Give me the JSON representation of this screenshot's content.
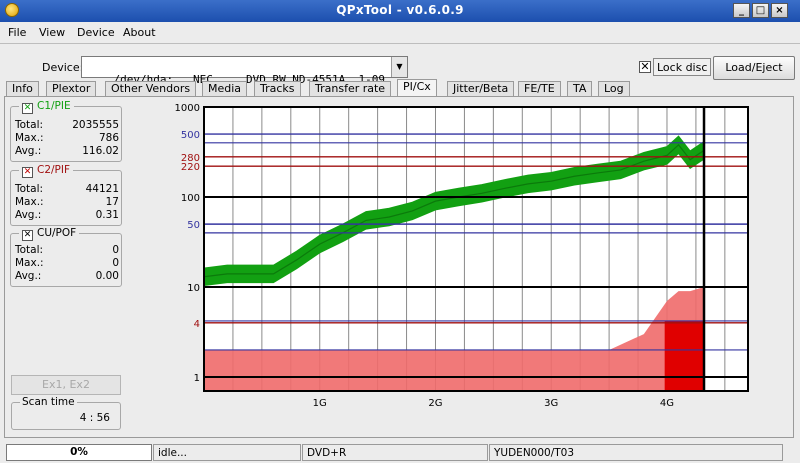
{
  "window": {
    "title": "QPxTool - v0.6.0.9"
  },
  "menu": [
    "File",
    "View",
    "Device",
    "About"
  ],
  "device": {
    "label": "Device:",
    "value": "/dev/hda:  _NEC     DVD_RW ND-4551A  1-09"
  },
  "lock": {
    "label": "Lock disc",
    "checked": true
  },
  "eject_label": "Load/Eject",
  "tabs": [
    "Info",
    "Plextor",
    "Other Vendors",
    "Media",
    "Tracks",
    "Transfer rate",
    "PI/Cx",
    "Jitter/Beta",
    "FE/TE",
    "TA",
    "Log"
  ],
  "active_tab": "PI/Cx",
  "stats": {
    "c1": {
      "title": "C1/PIE",
      "total_label": "Total:",
      "total": "2035555",
      "max_label": "Max.:",
      "max": "786",
      "avg_label": "Avg.:",
      "avg": "116.02"
    },
    "c2": {
      "title": "C2/PIF",
      "total_label": "Total:",
      "total": "44121",
      "max_label": "Max.:",
      "max": "17",
      "avg_label": "Avg.:",
      "avg": "0.31"
    },
    "cu": {
      "title": "CU/POF",
      "total_label": "Total:",
      "total": "0",
      "max_label": "Max.:",
      "max": "0",
      "avg_label": "Avg.:",
      "avg": "0.00"
    }
  },
  "exec_button": "Ex1, Ex2",
  "scan_time": {
    "label": "Scan time",
    "value": "4 : 56"
  },
  "colors": {
    "pie": "#12a012",
    "pif": "#f06a6a",
    "pif_dense": "#e00000",
    "blue_line": "#3434a0",
    "red_line": "#a01010"
  },
  "chart_data": {
    "type": "area",
    "y_scale": "log",
    "ylim": [
      0.7,
      1000
    ],
    "xlim": [
      0,
      4.7
    ],
    "y_ticks": [
      {
        "value": 1000,
        "label": "1000",
        "color": "black"
      },
      {
        "value": 500,
        "label": "500",
        "color": "blue"
      },
      {
        "value": 280,
        "label": "280",
        "color": "red"
      },
      {
        "value": 220,
        "label": "220",
        "color": "red"
      },
      {
        "value": 100,
        "label": "100",
        "color": "black"
      },
      {
        "value": 50,
        "label": "50",
        "color": "blue"
      },
      {
        "value": 10,
        "label": "10",
        "color": "black"
      },
      {
        "value": 4,
        "label": "4",
        "color": "red"
      },
      {
        "value": 1,
        "label": "1",
        "color": "black"
      }
    ],
    "blue_lines": [
      400,
      40,
      4.2,
      2
    ],
    "x_ticks": [
      {
        "value": 1,
        "label": "1G"
      },
      {
        "value": 2,
        "label": "2G"
      },
      {
        "value": 3,
        "label": "3G"
      },
      {
        "value": 4,
        "label": "4G"
      }
    ],
    "scan_end": 4.32,
    "series": [
      {
        "name": "C1/PIE",
        "points": [
          [
            0,
            13
          ],
          [
            0.2,
            14
          ],
          [
            0.4,
            14
          ],
          [
            0.6,
            14
          ],
          [
            0.8,
            20
          ],
          [
            1.0,
            30
          ],
          [
            1.2,
            40
          ],
          [
            1.4,
            55
          ],
          [
            1.6,
            60
          ],
          [
            1.8,
            70
          ],
          [
            2.0,
            90
          ],
          [
            2.2,
            100
          ],
          [
            2.4,
            110
          ],
          [
            2.6,
            125
          ],
          [
            2.8,
            140
          ],
          [
            3.0,
            150
          ],
          [
            3.2,
            170
          ],
          [
            3.4,
            185
          ],
          [
            3.6,
            200
          ],
          [
            3.8,
            250
          ],
          [
            4.0,
            290
          ],
          [
            4.1,
            380
          ],
          [
            4.2,
            260
          ],
          [
            4.32,
            330
          ]
        ]
      },
      {
        "name": "C2/PIF",
        "points": [
          [
            0,
            2
          ],
          [
            0.5,
            2
          ],
          [
            1.0,
            2
          ],
          [
            1.5,
            2
          ],
          [
            2.0,
            2
          ],
          [
            2.5,
            2
          ],
          [
            3.0,
            2
          ],
          [
            3.5,
            2
          ],
          [
            3.8,
            3
          ],
          [
            4.0,
            7
          ],
          [
            4.1,
            9
          ],
          [
            4.2,
            9
          ],
          [
            4.32,
            10
          ]
        ]
      }
    ]
  },
  "status": {
    "progress": "0%",
    "progress_value": 0,
    "state": "idle...",
    "media": "DVD+R",
    "media_id": "YUDEN000/T03"
  }
}
